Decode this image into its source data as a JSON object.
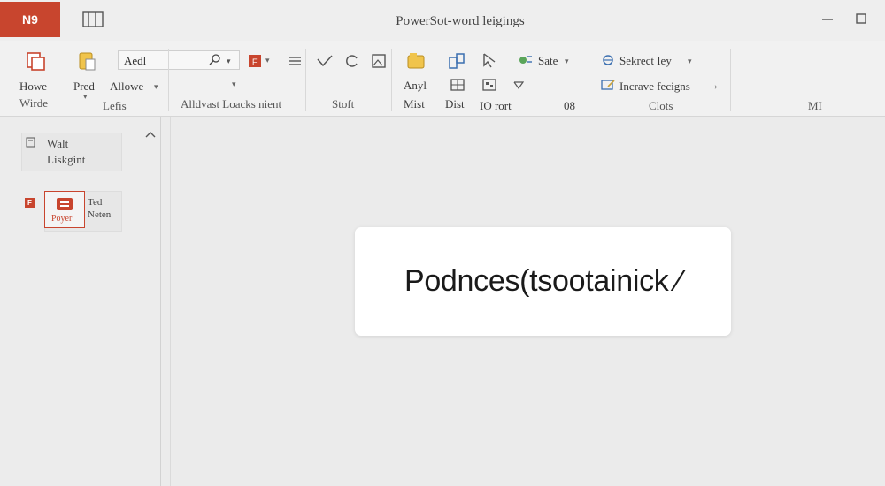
{
  "app": {
    "badge": "N9",
    "title": "PowerSot-word leigings",
    "accent": "#c8452e"
  },
  "ribbon": {
    "home": "Howe",
    "home_sub": "Wirde",
    "pred": "Pred",
    "allowe": "Allowe",
    "lefts": "Lefis",
    "font_value": "Aedl",
    "group_clipboard": "Alldvast Loacks nient",
    "group_shift": "Stoft",
    "anyl": "Anyl",
    "mist": "Mist",
    "dist": "Dist",
    "sort": "IO rort",
    "num": "08",
    "sate": "Sate",
    "select_key": "Sekrect Iey",
    "increase": "Incrave fecigns",
    "clots": "Clots",
    "mi": "MI"
  },
  "leftpane": {
    "card1_line1": "Walt",
    "card1_line2": "Liskgint",
    "card2_line1": "Ted",
    "card2_line2": "Neten",
    "thumb_caption": "Poyer",
    "mark": "F"
  },
  "dialog": {
    "text": "Podnces(tsootainick ⁄"
  },
  "icons": [
    "layout-icon",
    "minimize-icon",
    "maximize-icon",
    "new-slide-icon",
    "paste-icon",
    "search-icon",
    "shape-red-icon",
    "list-icon",
    "check-icon",
    "refresh-icon",
    "image-icon",
    "folder-icon",
    "arrange-icon",
    "select-arrow-icon",
    "grid-icon",
    "chart-icon",
    "filter-icon",
    "sate-icon",
    "select-key-icon",
    "increase-icon",
    "collapse-icon"
  ]
}
